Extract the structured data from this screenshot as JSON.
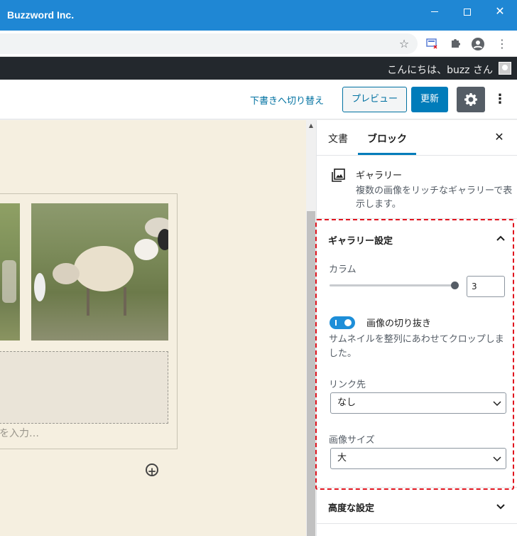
{
  "window": {
    "title": "Buzzword Inc."
  },
  "adminbar": {
    "greeting": "こんにちは、buzz さん"
  },
  "header": {
    "switch_draft": "下書きへ切り替え",
    "preview": "プレビュー",
    "update": "更新"
  },
  "canvas": {
    "caption_placeholder": "を入力…"
  },
  "sidebar": {
    "tabs": [
      {
        "label": "文書"
      },
      {
        "label": "ブロック"
      }
    ],
    "active_tab": "ブロック",
    "block": {
      "title": "ギャラリー",
      "description": "複数の画像をリッチなギャラリーで表示します。"
    },
    "gallery_settings": {
      "title": "ギャラリー設定",
      "columns_label": "カラム",
      "columns_value": "3",
      "columns_range": [
        1,
        3
      ],
      "crop_label": "画像の切り抜き",
      "crop_enabled": true,
      "crop_help": "サムネイルを整列にあわせてクロップしました。",
      "link_label": "リンク先",
      "link_value": "なし",
      "size_label": "画像サイズ",
      "size_value": "大"
    },
    "advanced": {
      "title": "高度な設定"
    }
  },
  "colors": {
    "titlebar": "#1f87d4",
    "admin_bar": "#23282d",
    "primary": "#007cba",
    "highlight": "#e0141e",
    "canvas": "#f5efe0"
  }
}
